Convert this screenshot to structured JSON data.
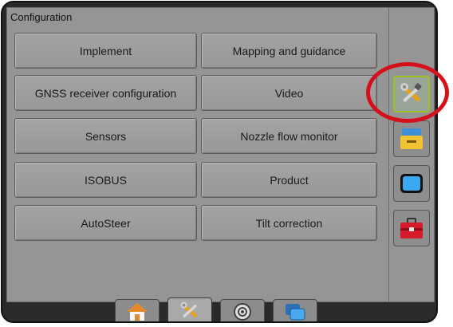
{
  "panel": {
    "title": "Configuration"
  },
  "menu": [
    {
      "left": "Implement",
      "right": "Mapping and guidance"
    },
    {
      "left": "GNSS receiver configuration",
      "right": "Video"
    },
    {
      "left": "Sensors",
      "right": "Nozzle flow monitor"
    },
    {
      "left": "ISOBUS",
      "right": "Product"
    },
    {
      "left": "AutoSteer",
      "right": "Tilt correction"
    }
  ],
  "side_tabs": [
    {
      "icon": "tools-icon",
      "active": true
    },
    {
      "icon": "console-icon",
      "active": false
    },
    {
      "icon": "display-icon",
      "active": false
    },
    {
      "icon": "toolbox-icon",
      "active": false
    }
  ],
  "bottom_tabs": [
    {
      "icon": "home-icon",
      "active": false
    },
    {
      "icon": "tools-icon",
      "active": true
    },
    {
      "icon": "gauge-icon",
      "active": false
    },
    {
      "icon": "screens-icon",
      "active": false
    }
  ],
  "colors": {
    "highlight_ring": "#d4101b",
    "active_border": "#9ac21e",
    "panel_bg": "#959595",
    "frame_bg": "#2a2a2a"
  }
}
